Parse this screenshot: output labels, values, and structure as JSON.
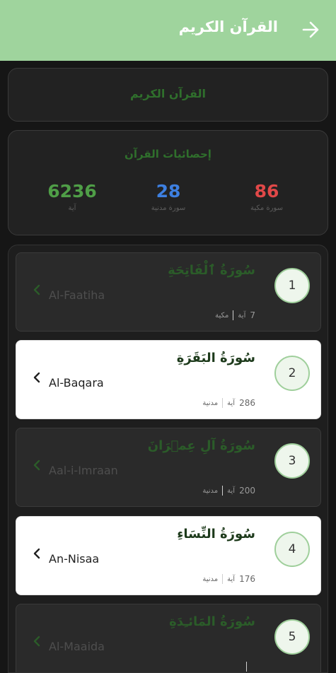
{
  "appbar": {
    "title": "القرآن الكريم",
    "back_icon": "arrow-back-icon"
  },
  "quran_card": {
    "label": "القرآن الكريم"
  },
  "stats": {
    "heading": "إحصائيات القرآن",
    "ayat": {
      "value": "6236",
      "caption": "آية",
      "color": "#4f9e47"
    },
    "madani": {
      "value": "28",
      "caption": "سورة مدنية",
      "color": "#3d7fe0"
    },
    "makki": {
      "value": "86",
      "caption": "سورة مكية",
      "color": "#e04848"
    }
  },
  "surahs": [
    {
      "number": "1",
      "arabic": "سُورَةُ ٱلْفَاتِحَةِ",
      "english": "Al-Faatiha",
      "ayah_count": "7",
      "ayah_word": "آية",
      "type": "مكية"
    },
    {
      "number": "2",
      "arabic": "سُورَةُ البَقَرَةِ",
      "english": "Al-Baqara",
      "ayah_count": "286",
      "ayah_word": "آية",
      "type": "مدنية"
    },
    {
      "number": "3",
      "arabic": "سُورَةُ آلِ عِمۡرَانَ",
      "english": "Aal-i-Imraan",
      "ayah_count": "200",
      "ayah_word": "آية",
      "type": "مدنية"
    },
    {
      "number": "4",
      "arabic": "سُورَةُ النِّسَاءِ",
      "english": "An-Nisaa",
      "ayah_count": "176",
      "ayah_word": "آية",
      "type": "مدنية"
    },
    {
      "number": "5",
      "arabic": "سُورَةُ المَائـِدَةِ",
      "english": "Al-Maaida",
      "ayah_count": "",
      "ayah_word": "",
      "type": ""
    }
  ]
}
